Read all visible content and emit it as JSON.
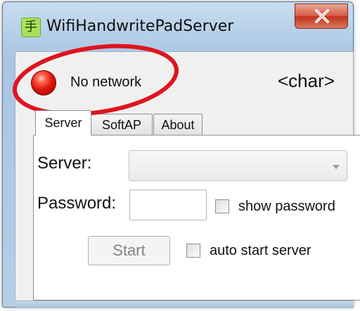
{
  "window": {
    "title": "WifiHandwritePadServer",
    "icon_glyph": "手",
    "close_label": "×"
  },
  "status": {
    "text": "No network",
    "indicator_color": "#e0180d",
    "char_placeholder": "<char>"
  },
  "tabs": [
    {
      "label": "Server",
      "active": true
    },
    {
      "label": "SoftAP",
      "active": false
    },
    {
      "label": "About",
      "active": false
    }
  ],
  "server_tab": {
    "server_label": "Server:",
    "server_value": "",
    "password_label": "Password:",
    "password_value": "",
    "show_password_label": "show password",
    "show_password_checked": false,
    "start_label": "Start",
    "start_enabled": false,
    "auto_start_label": "auto start server",
    "auto_start_checked": false
  },
  "annotation": {
    "color": "#e0141e"
  }
}
